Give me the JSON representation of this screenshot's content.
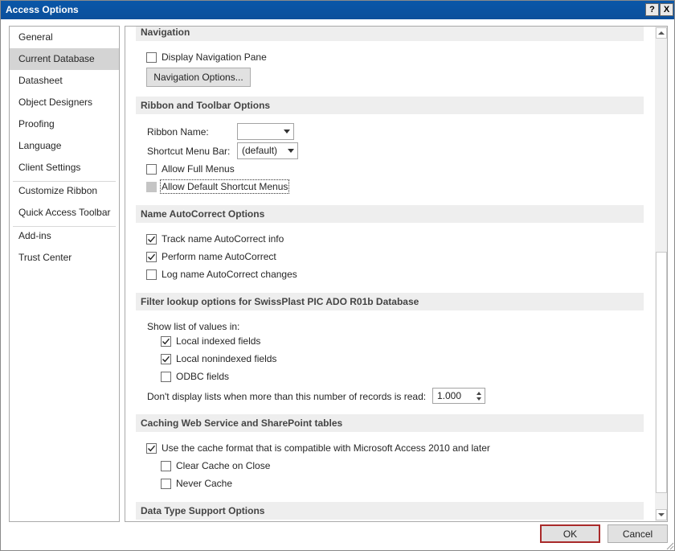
{
  "window": {
    "title": "Access Options",
    "help_glyph": "?",
    "close_glyph": "X"
  },
  "nav": {
    "items": [
      {
        "label": "General"
      },
      {
        "label": "Current Database"
      },
      {
        "label": "Datasheet"
      },
      {
        "label": "Object Designers"
      },
      {
        "label": "Proofing"
      },
      {
        "label": "Language"
      },
      {
        "label": "Client Settings"
      },
      {
        "label": "Customize Ribbon"
      },
      {
        "label": "Quick Access Toolbar"
      },
      {
        "label": "Add-ins"
      },
      {
        "label": "Trust Center"
      }
    ],
    "selected": "Current Database"
  },
  "navigation": {
    "header": "Navigation",
    "display_nav_pane": {
      "label": "Display Navigation Pane",
      "checked": false
    },
    "nav_options_button": "Navigation Options..."
  },
  "ribbon": {
    "header": "Ribbon and Toolbar Options",
    "ribbon_name_label": "Ribbon Name:",
    "ribbon_name_value": "",
    "shortcut_menu_label": "Shortcut Menu Bar:",
    "shortcut_menu_value": "(default)",
    "allow_full_menus": {
      "label": "Allow Full Menus",
      "checked": false
    },
    "allow_default_shortcut": {
      "label": "Allow Default Shortcut Menus",
      "checked": false,
      "disabled": true
    }
  },
  "autocorrect": {
    "header": "Name AutoCorrect Options",
    "track": {
      "label": "Track name AutoCorrect info",
      "checked": true
    },
    "perform": {
      "label": "Perform name AutoCorrect",
      "checked": true
    },
    "log": {
      "label": "Log name AutoCorrect changes",
      "checked": false
    }
  },
  "filter": {
    "header": "Filter lookup options for SwissPlast PIC ADO R01b Database",
    "show_list_label": "Show list of values in:",
    "local_indexed": {
      "label": "Local indexed fields",
      "checked": true
    },
    "local_nonindexed": {
      "label": "Local nonindexed fields",
      "checked": true
    },
    "odbc": {
      "label": "ODBC fields",
      "checked": false
    },
    "records_label": "Don't display lists when more than this number of records is read:",
    "records_value": "1.000"
  },
  "caching": {
    "header": "Caching Web Service and SharePoint tables",
    "use_cache": {
      "label": "Use the cache format that is compatible with Microsoft Access 2010 and later",
      "checked": true
    },
    "clear_cache": {
      "label": "Clear Cache on Close",
      "checked": false
    },
    "never_cache": {
      "label": "Never Cache",
      "checked": false
    }
  },
  "datatype": {
    "header": "Data Type Support Options"
  },
  "footer": {
    "ok": "OK",
    "cancel": "Cancel"
  },
  "colors": {
    "title_bar": "#0a57a8",
    "selected_nav": "#d4d4d4",
    "section_bg": "#eeeeee",
    "default_button_border": "#a92a2a"
  }
}
